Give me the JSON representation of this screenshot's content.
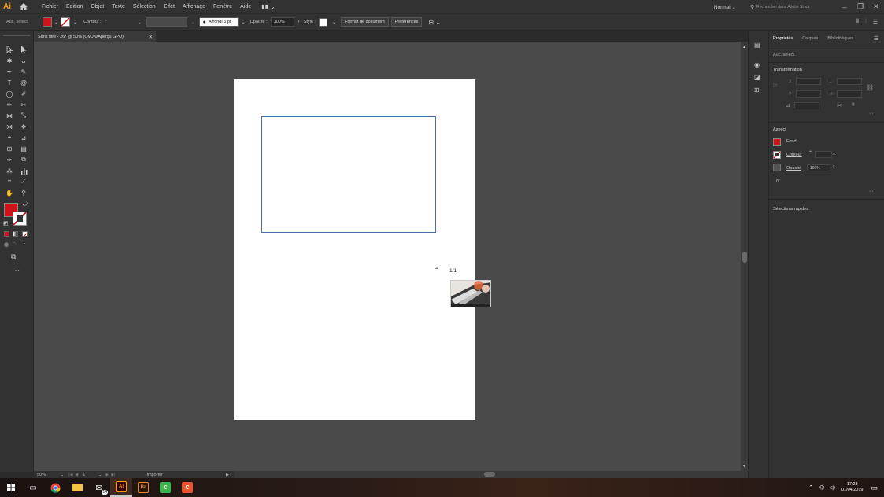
{
  "menubar": {
    "logo": "Ai",
    "items": [
      "Fichier",
      "Edition",
      "Objet",
      "Texte",
      "Sélection",
      "Effet",
      "Affichage",
      "Fenêtre",
      "Aide"
    ],
    "workspace": "Normal",
    "search_placeholder": "Rechercher dans Adobe Stock"
  },
  "controlbar": {
    "selection_label": "Auc. sélect.",
    "fill_color": "#d0121b",
    "stroke_label": "Contour :",
    "brush_label": "Arrondi 5 pt",
    "opacity_label": "Opacité :",
    "opacity_value": "100%",
    "style_label": "Style :",
    "doc_format_button": "Format de document",
    "prefs_button": "Préférences"
  },
  "document": {
    "tab_title": "Sans titre - 26* @ 50% (CMJN/Aperçu GPU)"
  },
  "canvas": {
    "place_counter": "1/1"
  },
  "statusbar": {
    "zoom": "50%",
    "page": "1",
    "mode": "Importer"
  },
  "panel": {
    "tabs": [
      "Propriétés",
      "Calques",
      "Bibliothèques"
    ],
    "no_selection": "Auc. sélect.",
    "transform_title": "Transformation",
    "x_label": "X :",
    "y_label": "Y :",
    "w_label": "L :",
    "h_label": "H :",
    "appearance_title": "Aspect",
    "fill_label": "Fond",
    "stroke_label": "Contour",
    "opacity_label": "Opacité",
    "opacity_value": "100%",
    "fx_label": "fx.",
    "quick_selections": "Sélections rapides"
  },
  "taskbar": {
    "time": "17:23",
    "date": "01/04/2019",
    "mail_badge": "14"
  },
  "colors": {
    "fill_red": "#d0121b",
    "ai_orange": "#ff9a00"
  }
}
